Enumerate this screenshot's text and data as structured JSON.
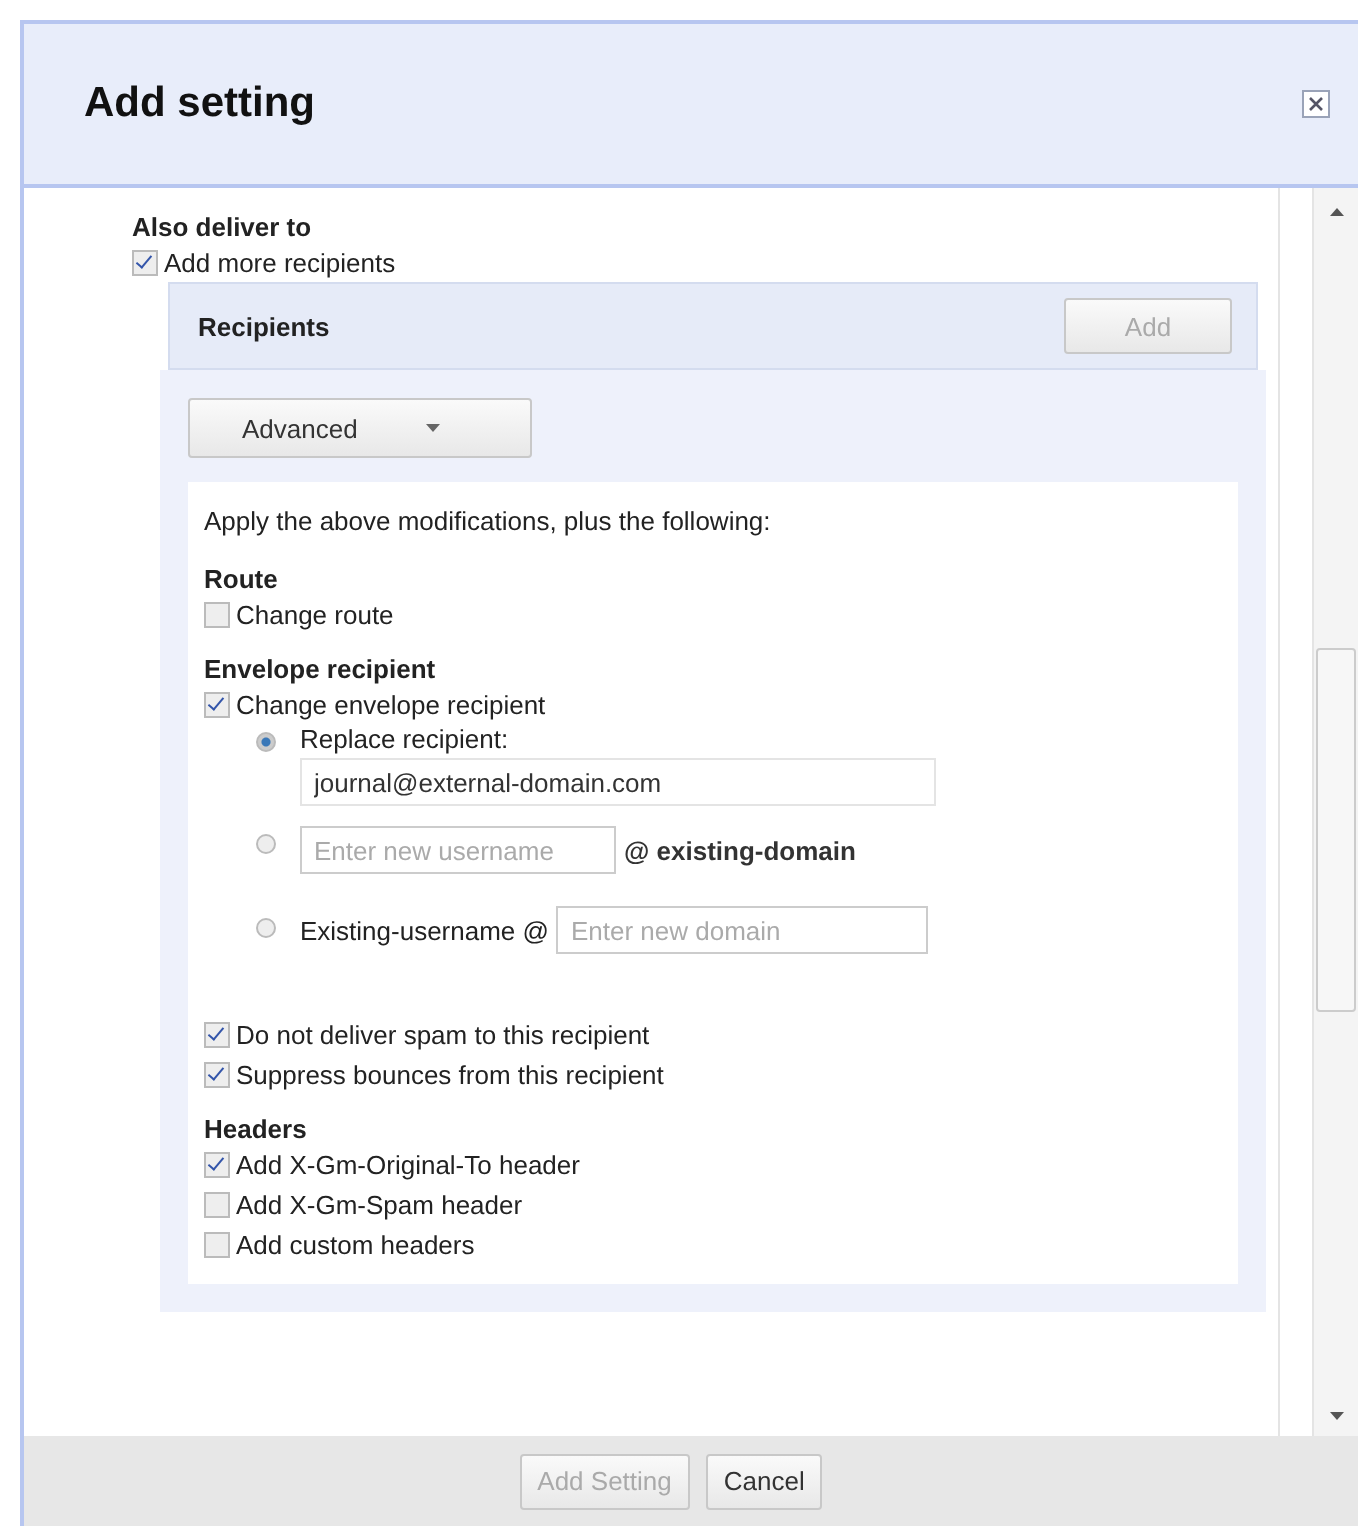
{
  "dialog": {
    "title": "Add setting"
  },
  "also_deliver": {
    "heading": "Also deliver to",
    "checkbox": {
      "label": "Add more recipients",
      "checked": true
    }
  },
  "recipients": {
    "title": "Recipients",
    "add_button": {
      "label": "Add",
      "disabled": true
    },
    "dropdown": {
      "label": "Advanced"
    },
    "intro": "Apply the above modifications, plus the following:",
    "route": {
      "heading": "Route",
      "checkbox": {
        "label": "Change route",
        "checked": false
      }
    },
    "envelope": {
      "heading": "Envelope recipient",
      "checkbox": {
        "label": "Change envelope recipient",
        "checked": true
      },
      "choices": [
        {
          "kind": "replace",
          "selected": true,
          "label": "Replace recipient:",
          "value": "journal@external-domain.com"
        },
        {
          "kind": "username",
          "selected": false,
          "placeholder": "Enter new username",
          "suffix": "@ existing-domain"
        },
        {
          "kind": "domain",
          "selected": false,
          "prefix": "Existing-username @",
          "placeholder": "Enter new domain"
        }
      ]
    },
    "options": [
      {
        "label": "Do not deliver spam to this recipient",
        "checked": true
      },
      {
        "label": "Suppress bounces from this recipient",
        "checked": true
      }
    ],
    "headers": {
      "heading": "Headers",
      "checkboxes": [
        {
          "label": "Add X-Gm-Original-To header",
          "checked": true
        },
        {
          "label": "Add X-Gm-Spam header",
          "checked": false
        },
        {
          "label": "Add custom headers",
          "checked": false
        }
      ]
    }
  },
  "footer": {
    "buttons": [
      {
        "label": "Add Setting",
        "disabled": true
      },
      {
        "label": "Cancel",
        "disabled": false
      }
    ]
  }
}
